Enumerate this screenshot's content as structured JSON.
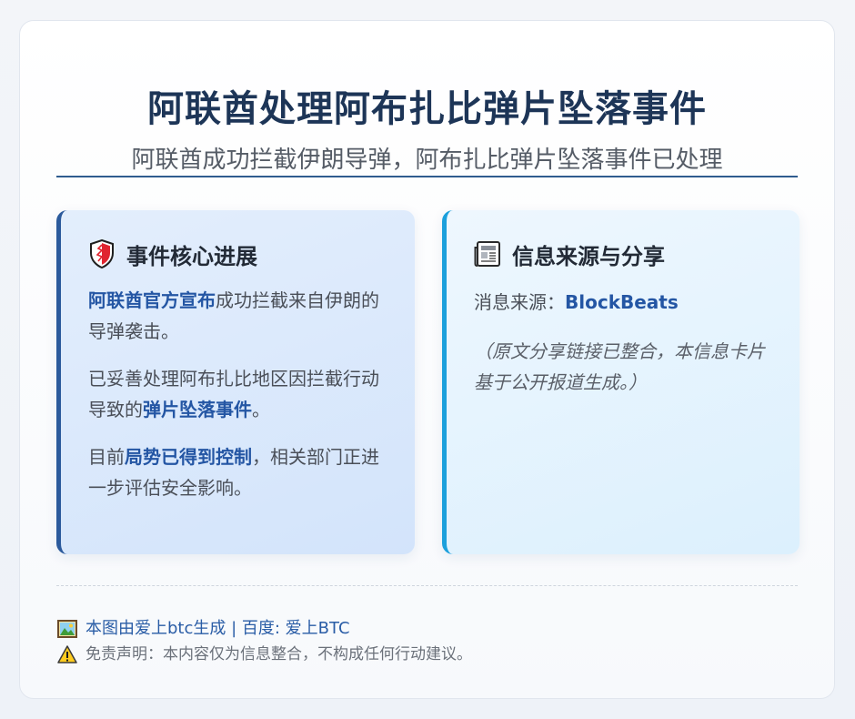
{
  "header": {
    "title": "阿联酋处理阿布扎比弹片坠落事件",
    "subtitle": "阿联酋成功拦截伊朗导弹，阿布扎比弹片坠落事件已处理"
  },
  "left_panel": {
    "icon": "shield-icon",
    "heading": "事件核心进展",
    "paragraphs": [
      {
        "highlight": "阿联酋官方宣布",
        "after": "成功拦截来自伊朗的导弹袭击。"
      },
      {
        "before": "已妥善处理阿布扎比地区因拦截行动导致的",
        "highlight": "弹片坠落事件",
        "after": "。"
      },
      {
        "before": "目前",
        "highlight": "局势已得到控制",
        "after": "，相关部门正进一步评估安全影响。"
      }
    ]
  },
  "right_panel": {
    "icon": "newspaper-icon",
    "heading": "信息来源与分享",
    "source_label": "消息来源：",
    "source_name": "BlockBeats",
    "note": "（原文分享链接已整合，本信息卡片基于公开报道生成。）"
  },
  "footer": {
    "credit_icon": "picture-icon",
    "credit": "本图由爱上btc生成 | 百度: 爱上BTC",
    "disclaimer_icon": "warning-icon",
    "disclaimer": "免责声明：本内容仅为信息整合，不构成任何行动建议。"
  },
  "colors": {
    "title": "#1d3557",
    "accent_left": "#2b5a9c",
    "accent_right": "#1ca0dc",
    "highlight": "#2456a4"
  }
}
